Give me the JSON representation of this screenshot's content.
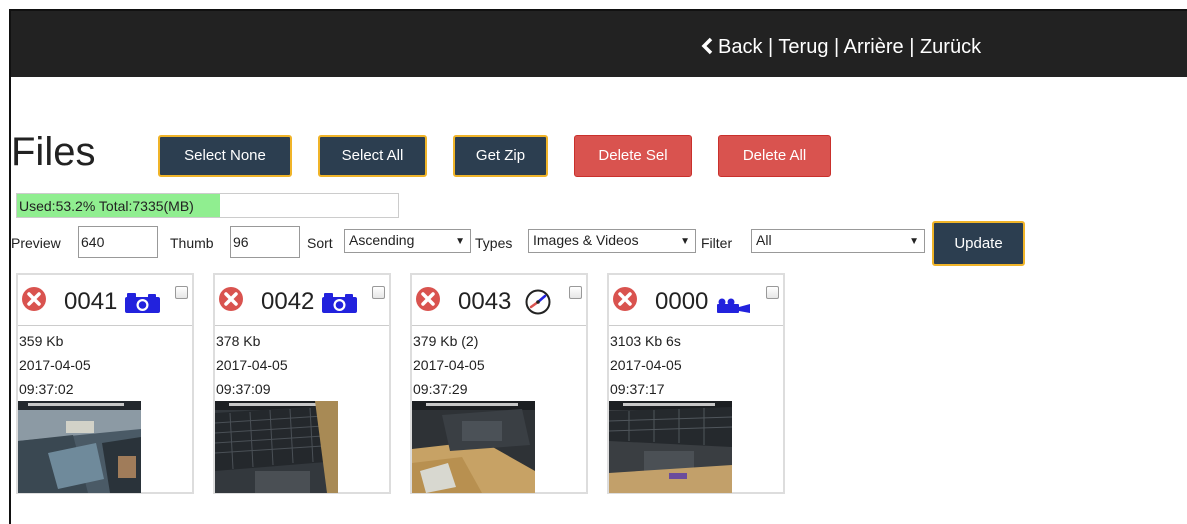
{
  "header": {
    "back_link": "Back | Terug | Arrière | Zurück"
  },
  "page": {
    "title": "Files"
  },
  "toolbar": {
    "select_none": "Select None",
    "select_all": "Select All",
    "get_zip": "Get Zip",
    "delete_sel": "Delete Sel",
    "delete_all": "Delete All"
  },
  "usage": {
    "label": "Used:53.2% Total:7335(MB)",
    "used_percent": 53.2
  },
  "controls": {
    "preview_label": "Preview",
    "preview_value": "640",
    "thumb_label": "Thumb",
    "thumb_value": "96",
    "sort_label": "Sort",
    "sort_value": "Ascending",
    "types_label": "Types",
    "types_value": "Images & Videos",
    "filter_label": "Filter",
    "filter_value": "All",
    "update_button": "Update"
  },
  "files": [
    {
      "number": "0041",
      "type_icon": "camera-icon",
      "size": "359 Kb",
      "date": "2017-04-05",
      "time": "09:37:02"
    },
    {
      "number": "0042",
      "type_icon": "camera-icon",
      "size": "378 Kb",
      "date": "2017-04-05",
      "time": "09:37:09"
    },
    {
      "number": "0043",
      "type_icon": "timelapse-icon",
      "size": "379 Kb (2)",
      "date": "2017-04-05",
      "time": "09:37:29"
    },
    {
      "number": "0000",
      "type_icon": "video-camera-icon",
      "size": "3103 Kb 6s",
      "date": "2017-04-05",
      "time": "09:37:17"
    }
  ],
  "colors": {
    "topbar": "#222222",
    "dark_button": "#2c3e50",
    "button_border": "#f0b429",
    "danger": "#d9534f",
    "usage_fill": "#90ee90",
    "icon_blue": "#2222dd"
  }
}
